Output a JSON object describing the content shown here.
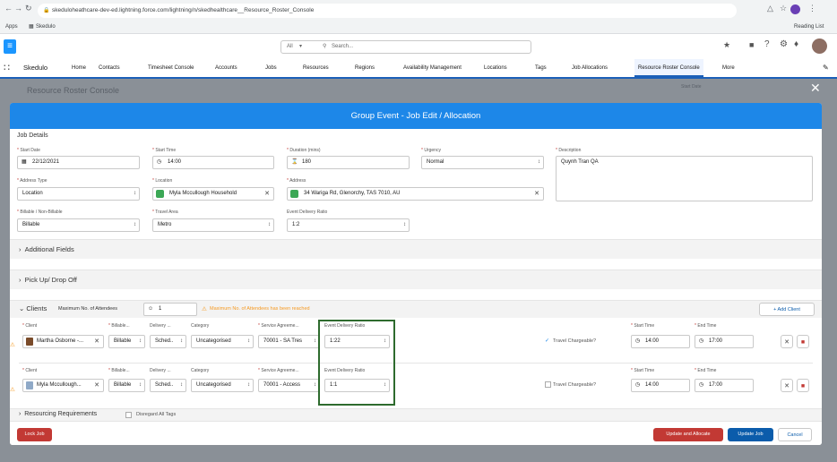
{
  "browser": {
    "url": "skeduloheathcare-dev-ed.lightning.force.com/lightning/n/skedhealthcare__Resource_Roster_Console",
    "bookmarks": [
      "Apps",
      "Skedulo"
    ],
    "reading_list": "Reading List"
  },
  "sf": {
    "search_scope": "All",
    "search_placeholder": "Search...",
    "app_name": "Skedulo",
    "nav": [
      "Home",
      "Contacts",
      "Timesheet Console",
      "Accounts",
      "Jobs",
      "Resources",
      "Regions",
      "Availability Management",
      "Locations",
      "Tags",
      "Job Allocations",
      "Resource Roster Console",
      "More"
    ],
    "active_nav": "Resource Roster Console",
    "page_title": "Resource Roster Console",
    "right_label": "Start Date"
  },
  "modal": {
    "title": "Group Event - Job Edit / Allocation",
    "section_job_details": "Job Details",
    "start_date_label": "Start Date",
    "start_date": "22/12/2021",
    "start_time_label": "Start Time",
    "start_time": "14:00",
    "duration_label": "Duration (mins)",
    "duration": "180",
    "urgency_label": "Urgency",
    "urgency": "Normal",
    "description_label": "Description",
    "description": "Quynh Tran QA",
    "address_type_label": "Address Type",
    "address_type": "Location",
    "location_label": "Location",
    "location": "Myla Mccullough Household",
    "address_label": "Address",
    "address": "34 Wariga Rd, Glenorchy, TAS 7010, AU",
    "billable_label": "Billable / Non-Billable",
    "billable": "Billable",
    "travel_area_label": "Travel Area",
    "travel_area": "Metro",
    "event_ratio_label": "Event Delivery Ratio",
    "event_ratio": "1:2",
    "additional_fields": "Additional Fields",
    "pickup": "Pick Up/ Drop Off",
    "clients": "Clients",
    "max_attendees_label": "Maximum No. of Attendees",
    "max_attendees": "1",
    "max_warning": "Maximum No. of Attendees has been reached",
    "add_client": "Add Client",
    "col_client": "Client",
    "col_billable": "Billable...",
    "col_delivery": "Delivery ...",
    "col_category": "Category",
    "col_service": "Service Agreeme...",
    "col_ratio": "Event Delivery Ratio",
    "col_start": "Start Time",
    "col_end": "End Time",
    "travel_chargeable": "Travel Chargeable?",
    "rows": [
      {
        "client": "Martha Osborne -...",
        "billable": "Billable",
        "delivery": "Sched..",
        "category": "Uncategorised",
        "service": "70001 - SA Tres",
        "ratio": "1:22",
        "start": "14:00",
        "end": "17:00",
        "travel": "checked"
      },
      {
        "client": "Myla Mccullough...",
        "billable": "Billable",
        "delivery": "Sched..",
        "category": "Uncategorised",
        "service": "70001 - Access",
        "ratio": "1:1",
        "start": "14:00",
        "end": "17:00",
        "travel": "unchecked"
      }
    ],
    "resourcing": "Resourcing Requirements",
    "disregard": "Disregard All Tags",
    "lock_job": "Lock Job",
    "update_allocate": "Update and Allocate",
    "update_job": "Update Job",
    "cancel": "Cancel"
  },
  "colors": {
    "modal_header": "#1d87e8",
    "nav_active": "#1b5fb8",
    "danger": "#c23934",
    "primary": "#0b5cab",
    "highlight": "#2e6b2e",
    "warning": "#f59a23"
  }
}
